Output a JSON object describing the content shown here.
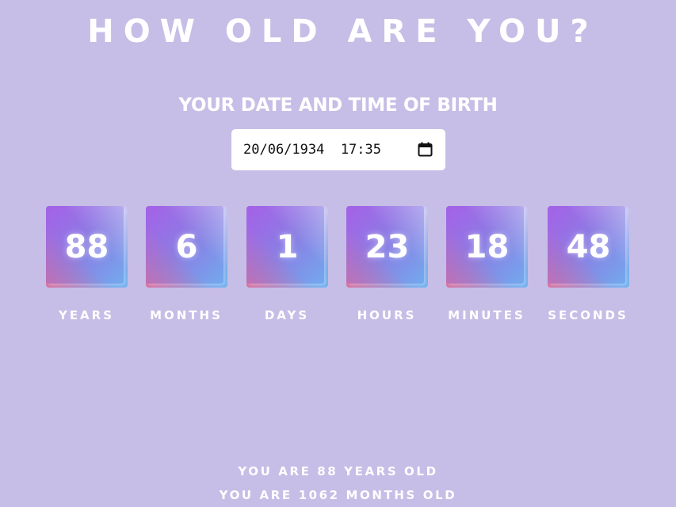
{
  "header": {
    "title": "HOW OLD ARE YOU?",
    "subtitle": "YOUR DATE AND TIME OF BIRTH"
  },
  "birth_input": {
    "value": "20/06/1934  17:35",
    "icon": "calendar-icon"
  },
  "units": [
    {
      "value": "88",
      "label": "YEARS"
    },
    {
      "value": "6",
      "label": "MONTHS"
    },
    {
      "value": "1",
      "label": "DAYS"
    },
    {
      "value": "23",
      "label": "HOURS"
    },
    {
      "value": "18",
      "label": "MINUTES"
    },
    {
      "value": "48",
      "label": "SECONDS"
    }
  ],
  "summary": {
    "line1": "YOU ARE 88 YEARS OLD",
    "line2": "YOU ARE 1062 MONTHS OLD"
  },
  "colors": {
    "background": "#c6bee6",
    "text": "#ffffff",
    "box_gradient_start": "#b057e8",
    "box_gradient_end": "#6fb2f0",
    "box_accent": "#e8688c"
  }
}
